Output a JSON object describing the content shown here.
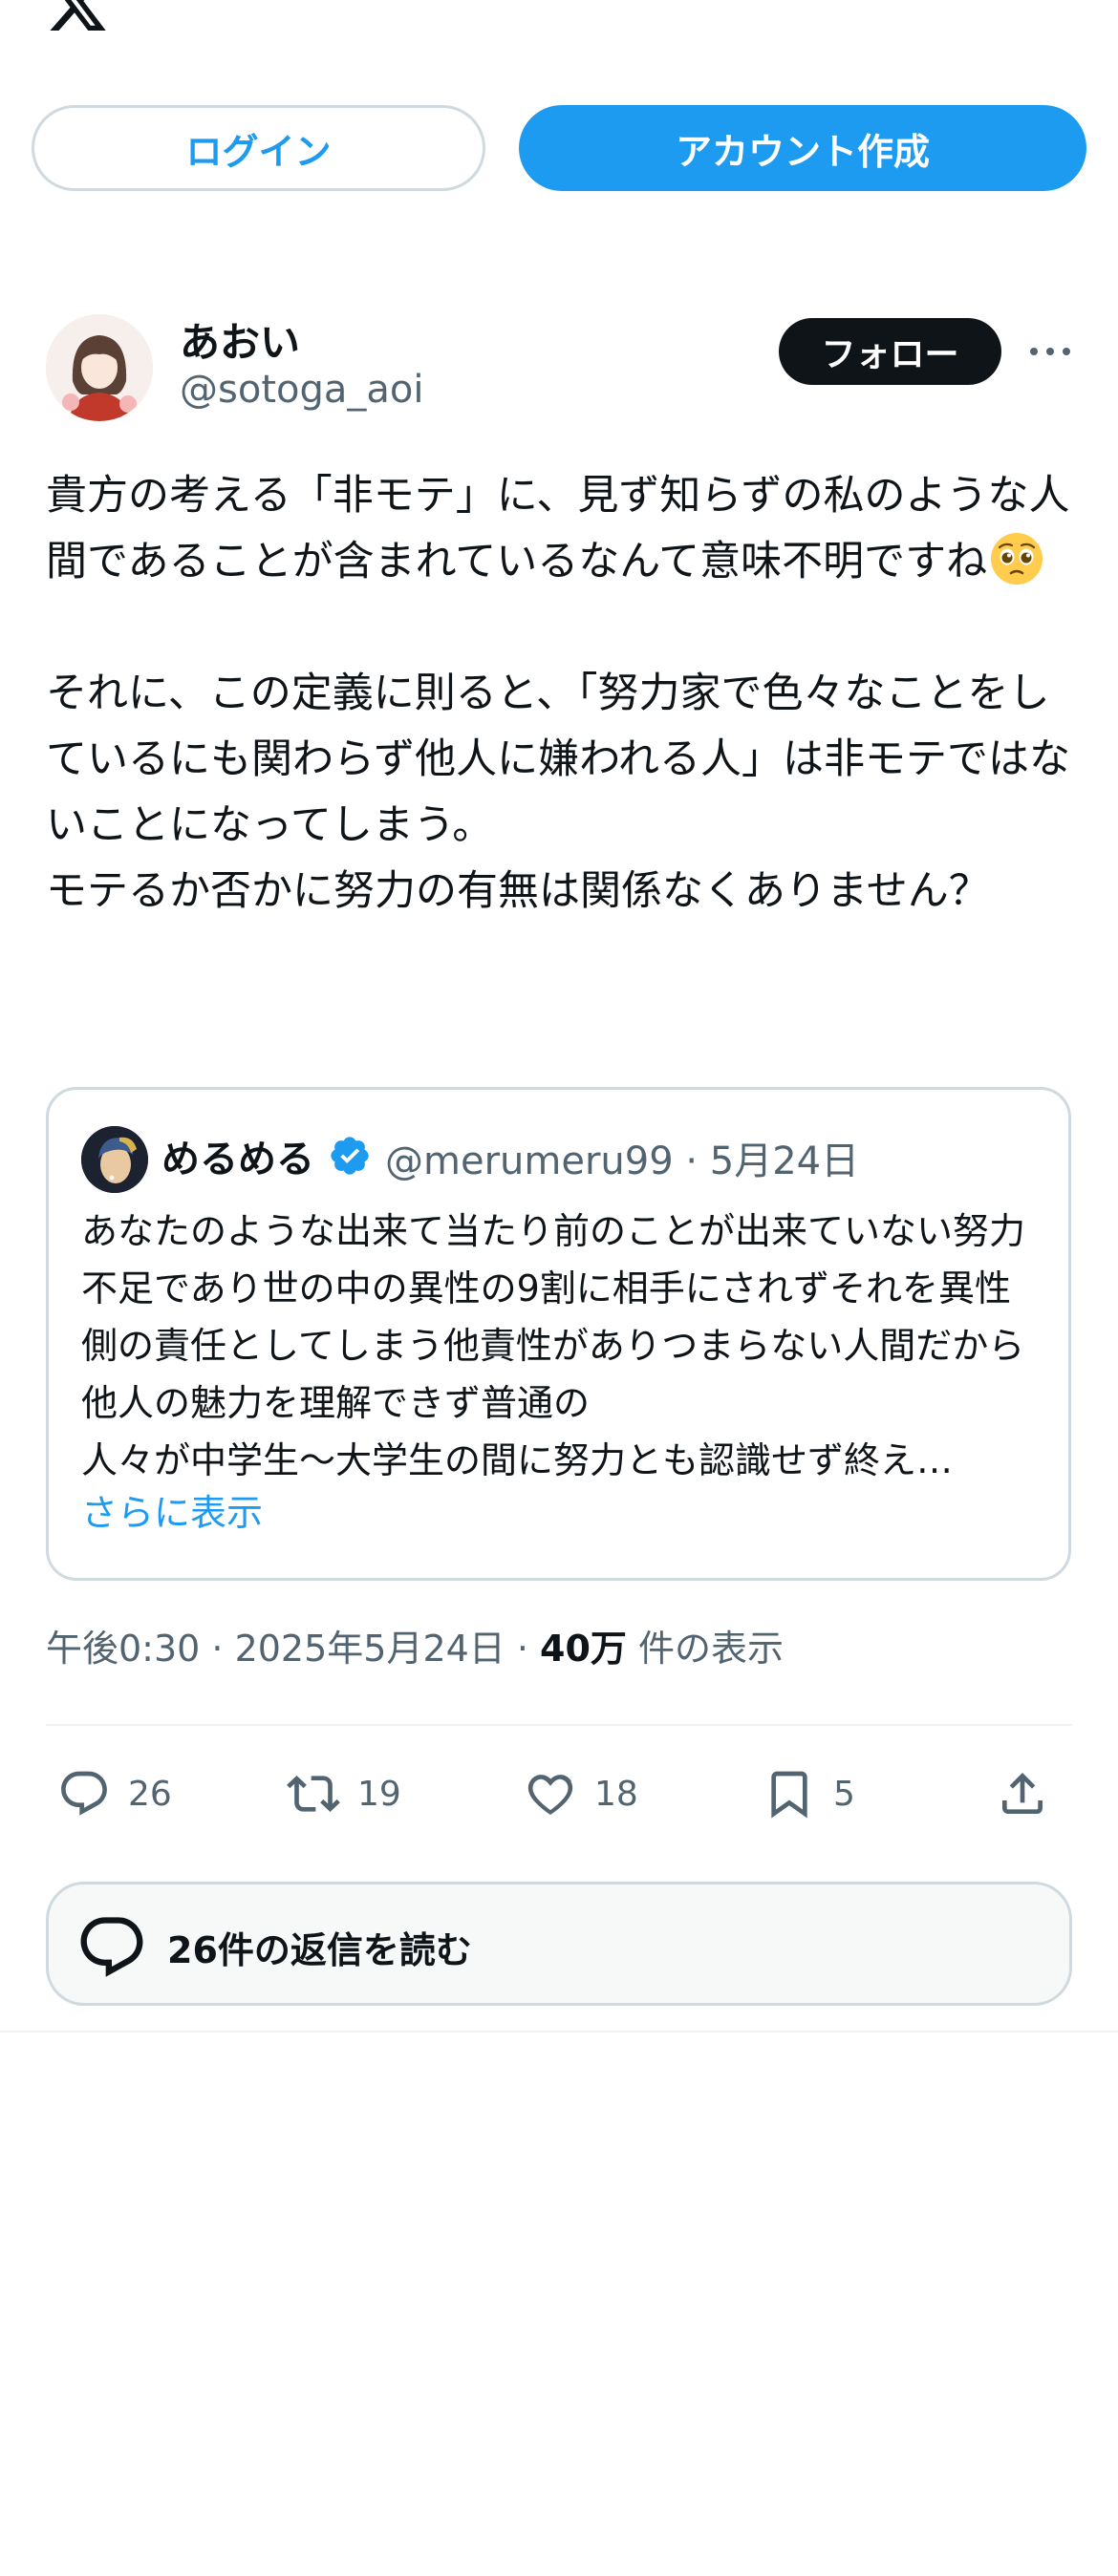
{
  "header": {
    "logo_icon": "x-logo-icon",
    "more_icon": "more-horizontal-icon"
  },
  "auth": {
    "login_label": "ログイン",
    "signup_label": "アカウント作成"
  },
  "post": {
    "author_name": "あおい",
    "author_handle": "@sotoga_aoi",
    "follow_label": "フォロー",
    "text_before_emoji": "貴方の考える「非モテ」に、見ず知らずの私のような人間であることが含まれているなんて意味不明ですね",
    "emoji": "pleading-face-emoji",
    "text_after_emoji": "\n\nそれに、この定義に則ると、「努力家で色々なことをしているにも関わらず他人に嫌われる人」は非モテではないことになってしまう。\nモテるか否かに努力の有無は関係なくありません？",
    "timestamp": "午後0:30 · 2025年5月24日 · ",
    "views_count": "40万",
    "views_label": " 件の表示"
  },
  "quote": {
    "name": "めるめる",
    "handle_date": "@merumeru99 · 5月24日",
    "text": "あなたのような出来て当たり前のことが出来ていない努力不足であり世の中の異性の9割に相手にされずそれを異性側の責任としてしまう他責性がありつまらない人間だから他人の魅力を理解できず普通の\n人々が中学生〜大学生の間に努力とも認識せず終え…",
    "show_more": "さらに表示"
  },
  "actions": {
    "reply_count": "26",
    "repost_count": "19",
    "like_count": "18",
    "bookmark_count": "5"
  },
  "replies_button": {
    "label": "26件の返信を読む"
  },
  "colors": {
    "accent": "#1d9bf0",
    "text": "#0f1419",
    "muted": "#536471",
    "border": "#cfd9de"
  }
}
